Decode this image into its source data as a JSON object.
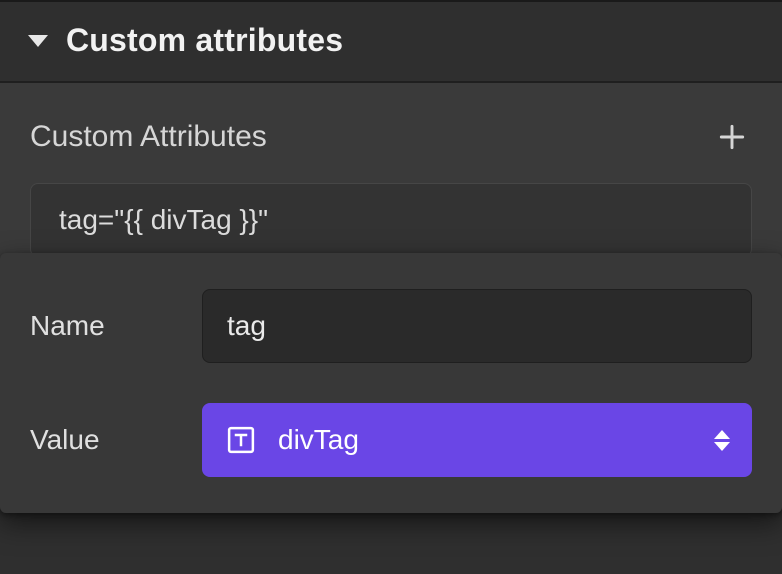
{
  "section": {
    "title": "Custom attributes"
  },
  "body": {
    "subtitle": "Custom Attributes",
    "attribute_display": "tag=\"{{ divTag }}\""
  },
  "editor": {
    "name_label": "Name",
    "name_value": "tag",
    "value_label": "Value",
    "value_binding": "divTag",
    "value_type": "text"
  },
  "colors": {
    "accent": "#6a46e6",
    "panel_bg": "#2f2f2f",
    "body_bg": "#3a3a3a",
    "input_bg": "#2a2a2a"
  }
}
